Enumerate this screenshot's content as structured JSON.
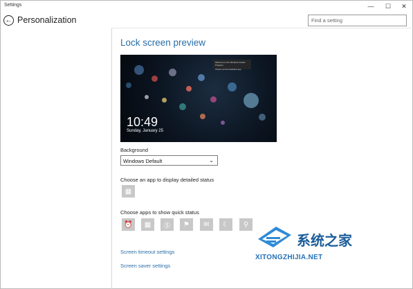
{
  "window": {
    "title": "Settings",
    "minimize": "—",
    "maximize": "☐",
    "close": "✕"
  },
  "header": {
    "back_glyph": "←",
    "title": "Personalization"
  },
  "search": {
    "placeholder": "Find a setting"
  },
  "section": {
    "title": "Lock screen preview"
  },
  "preview": {
    "time": "10:49",
    "date": "Sunday, January 25",
    "notification_lines": [
      "Welcome to the Windows Insider Program.",
      "Check out the feedback app."
    ]
  },
  "background": {
    "label": "Background",
    "selected": "Windows Default"
  },
  "detailed_status": {
    "label": "Choose an app to display detailed status",
    "icon": "calendar-icon"
  },
  "quick_status": {
    "label": "Choose apps to show quick status",
    "icons": [
      "alarm-icon",
      "calendar-icon",
      "skype-icon",
      "maps-icon",
      "mail-icon",
      "weather-icon",
      "search-icon"
    ]
  },
  "links": {
    "timeout": "Screen timeout settings",
    "saver": "Screen saver settings"
  },
  "watermark": {
    "text": "系统之家",
    "sub": "XITONGZHIJIA.NET"
  },
  "colors": {
    "accent": "#2a6ea8",
    "tile": "#c8c8c8"
  }
}
